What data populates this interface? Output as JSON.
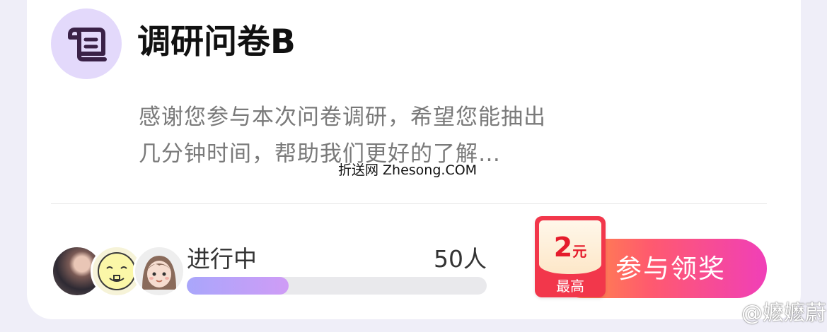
{
  "survey": {
    "title": "调研问卷B",
    "description": "感谢您参与本次问卷调研，希望您能抽出几分钟时间，帮助我们更好的了解…"
  },
  "status": {
    "label": "进行中",
    "participants": "50人",
    "progress_fraction": 0.34
  },
  "avatars": [
    {
      "name": "avatar-woman"
    },
    {
      "name": "avatar-cartoon-baby"
    },
    {
      "name": "avatar-cartoon-girl"
    }
  ],
  "reward": {
    "amount": "2",
    "unit": "元",
    "label": "最高",
    "button_label": "参与领奖"
  },
  "watermarks": {
    "site": "折送网 Zhesong.COM",
    "weibo": "@嬷嬷蔚"
  },
  "colors": {
    "accent_purple": "#cf9cf6",
    "button_orange": "#ff9a3d",
    "button_pink": "#f03fb8",
    "prize_red": "#f2374b"
  },
  "icons": [
    "scroll-icon"
  ]
}
